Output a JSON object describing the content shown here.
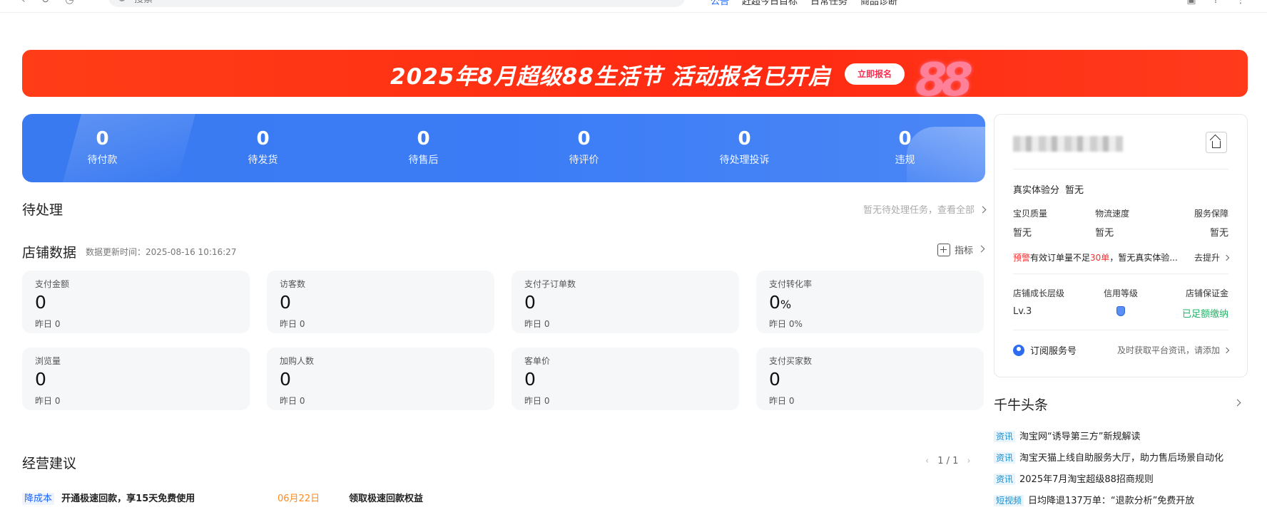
{
  "topbar": {
    "search_placeholder": "搜索",
    "menu": [
      "公告",
      "赶超今日目标",
      "日常任务",
      "商品诊断"
    ]
  },
  "banner": {
    "title": "2025年8月超级88生活节 活动报名已开启",
    "cta": "立即报名",
    "brand_colors": {
      "start": "#ff3d17",
      "end": "#ff3b1c"
    }
  },
  "stats": [
    {
      "value": "0",
      "label": "待付款"
    },
    {
      "value": "0",
      "label": "待发货"
    },
    {
      "value": "0",
      "label": "待售后"
    },
    {
      "value": "0",
      "label": "待评价"
    },
    {
      "value": "0",
      "label": "待处理投诉"
    },
    {
      "value": "0",
      "label": "违规"
    }
  ],
  "pending": {
    "title": "待处理",
    "link": "暂无待处理任务，查看全部"
  },
  "store": {
    "title": "店铺数据",
    "update_time": "数据更新时间：2025-08-16 10:16:27",
    "metric_link": "指标",
    "cards": [
      {
        "label": "支付金额",
        "value": "0",
        "unit": "",
        "yesterday": "昨日 0"
      },
      {
        "label": "访客数",
        "value": "0",
        "unit": "",
        "yesterday": "昨日 0"
      },
      {
        "label": "支付子订单数",
        "value": "0",
        "unit": "",
        "yesterday": "昨日 0"
      },
      {
        "label": "支付转化率",
        "value": "0",
        "unit": "%",
        "yesterday": "昨日 0%"
      },
      {
        "label": "浏览量",
        "value": "0",
        "unit": "",
        "yesterday": "昨日 0"
      },
      {
        "label": "加购人数",
        "value": "0",
        "unit": "",
        "yesterday": "昨日 0"
      },
      {
        "label": "客单价",
        "value": "0",
        "unit": "",
        "yesterday": "昨日 0"
      },
      {
        "label": "支付买家数",
        "value": "0",
        "unit": "",
        "yesterday": "昨日 0"
      }
    ]
  },
  "advice": {
    "title": "经营建议",
    "pager": "1 / 1",
    "row": {
      "tag": "降成本",
      "text": "开通极速回款，享15天免费使用",
      "date": "06月22日",
      "task": "领取极速回款权益"
    }
  },
  "profile": {
    "experience_label": "真实体验分",
    "experience_value": "暂无",
    "metrics_labels": [
      "宝贝质量",
      "物流速度",
      "服务保障"
    ],
    "metrics_values": [
      "暂无",
      "暂无",
      "暂无"
    ],
    "warning_tag": "预警",
    "warning_text_a": "有效订单量不足",
    "warning_highlight": "30单",
    "warning_text_b": "，暂无真实体验...",
    "warning_action": "去提升",
    "levels_labels": [
      "店铺成长层级",
      "信用等级",
      "店铺保证金"
    ],
    "growth_level": "Lv.3",
    "deposit_status": "已足额缴纳",
    "subscribe_label": "订阅服务号",
    "subscribe_hint": "及时获取平台资讯，请添加"
  },
  "news": {
    "title": "千牛头条",
    "items": [
      {
        "tag": "资讯",
        "text": "淘宝网“诱导第三方”新规解读"
      },
      {
        "tag": "资讯",
        "text": "淘宝天猫上线自助服务大厅，助力售后场景自动化"
      },
      {
        "tag": "资讯",
        "text": "2025年7月淘宝超级88招商规则"
      },
      {
        "tag": "短视频",
        "text": "日均降退137万单：“退款分析”免费开放"
      }
    ]
  }
}
